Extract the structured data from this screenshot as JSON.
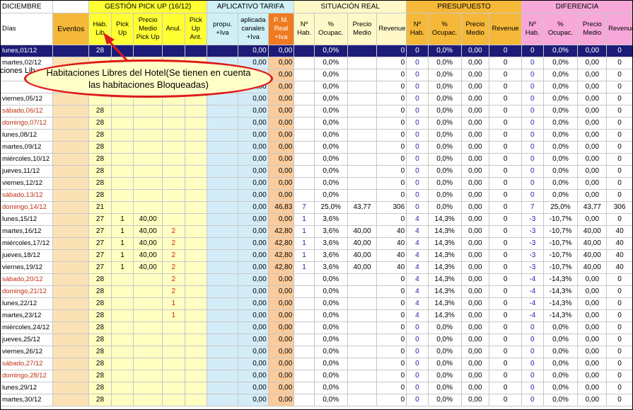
{
  "month_label": "DICIEMBRE",
  "days_label": "Días",
  "group_headers": {
    "pickup": "GESTIÓN PICK UP (16/12)",
    "tarifa": "APLICATIVO TARIFA",
    "situacion": "SITUACIÓN REAL",
    "presupuesto": "PRESUPUESTO",
    "diferencia": "DIFERENCIA"
  },
  "column_headers": {
    "eventos": "Eventos",
    "hab_lib": "Hab. Lib",
    "pick_up": "Pick Up",
    "precio_pickup": "Precio Medio Pick Up",
    "anul": "Anul.",
    "pickup_ant": "Pick Up Ant.",
    "propu": "propu. +Iva",
    "aplicada": "aplicada canales +Iva",
    "pm_real": "P. M. Real +Iva",
    "n_hab": "Nº Hab.",
    "ocupac": "% Ocupac.",
    "precio_medio": "Precio Medio",
    "revenue": "Revenue"
  },
  "overflow_text": "ciones Lib",
  "annotation": "Habitaciones Libres del Hotel(Se tienen en cuenta las habitaciones Bloqueadas)",
  "rows": [
    {
      "day": "lunes,01/12",
      "we": false,
      "sel": true,
      "hab": "28",
      "pick": "",
      "pmp": "",
      "anul": "",
      "pua": "",
      "propu": "0,00",
      "aplic": "0,00",
      "pmr": "",
      "s_n": "",
      "s_oc": "0,0%",
      "s_pm": "",
      "s_rev": "0",
      "p_n": "0",
      "p_oc": "0,0%",
      "p_pm": "0,00",
      "p_rev": "0",
      "d_n": "0",
      "d_oc": "0,0%",
      "d_pm": "0,00",
      "d_rev": "0"
    },
    {
      "day": "martes,02/12",
      "we": false,
      "hab": "",
      "pick": "",
      "pmp": "",
      "anul": "",
      "pua": "",
      "propu": "0,00",
      "aplic": "0,00",
      "pmr": "",
      "s_n": "",
      "s_oc": "0,0%",
      "s_pm": "",
      "s_rev": "0",
      "p_n": "0",
      "p_oc": "0,0%",
      "p_pm": "0,00",
      "p_rev": "0",
      "d_n": "0",
      "d_oc": "0,0%",
      "d_pm": "0,00",
      "d_rev": "0"
    },
    {
      "day": "",
      "we": false,
      "hab": "",
      "pick": "",
      "pmp": "",
      "anul": "",
      "pua": "",
      "propu": "0,00",
      "aplic": "0,00",
      "pmr": "",
      "s_n": "",
      "s_oc": "0,0%",
      "s_pm": "",
      "s_rev": "0",
      "p_n": "0",
      "p_oc": "0,0%",
      "p_pm": "0,00",
      "p_rev": "0",
      "d_n": "0",
      "d_oc": "0,0%",
      "d_pm": "0,00",
      "d_rev": "0"
    },
    {
      "day": "",
      "we": false,
      "hab": "",
      "pick": "",
      "pmp": "",
      "anul": "",
      "pua": "",
      "propu": "0,00",
      "aplic": "0,00",
      "pmr": "",
      "s_n": "",
      "s_oc": "0,0%",
      "s_pm": "",
      "s_rev": "0",
      "p_n": "0",
      "p_oc": "0,0%",
      "p_pm": "0,00",
      "p_rev": "0",
      "d_n": "0",
      "d_oc": "0,0%",
      "d_pm": "0,00",
      "d_rev": "0"
    },
    {
      "day": "viernes,05/12",
      "we": false,
      "hab": "",
      "pick": "",
      "pmp": "",
      "anul": "",
      "pua": "",
      "propu": "0,00",
      "aplic": "0,00",
      "pmr": "",
      "s_n": "",
      "s_oc": "0,0%",
      "s_pm": "",
      "s_rev": "0",
      "p_n": "0",
      "p_oc": "0,0%",
      "p_pm": "0,00",
      "p_rev": "0",
      "d_n": "0",
      "d_oc": "0,0%",
      "d_pm": "0,00",
      "d_rev": "0"
    },
    {
      "day": "sábado,06/12",
      "we": true,
      "hab": "28",
      "pick": "",
      "pmp": "",
      "anul": "",
      "pua": "",
      "propu": "0,00",
      "aplic": "0,00",
      "pmr": "",
      "s_n": "",
      "s_oc": "0,0%",
      "s_pm": "",
      "s_rev": "0",
      "p_n": "0",
      "p_oc": "0,0%",
      "p_pm": "0,00",
      "p_rev": "0",
      "d_n": "0",
      "d_oc": "0,0%",
      "d_pm": "0,00",
      "d_rev": "0"
    },
    {
      "day": "domingo,07/12",
      "we": true,
      "hab": "28",
      "pick": "",
      "pmp": "",
      "anul": "",
      "pua": "",
      "propu": "0,00",
      "aplic": "0,00",
      "pmr": "",
      "s_n": "",
      "s_oc": "0,0%",
      "s_pm": "",
      "s_rev": "0",
      "p_n": "0",
      "p_oc": "0,0%",
      "p_pm": "0,00",
      "p_rev": "0",
      "d_n": "0",
      "d_oc": "0,0%",
      "d_pm": "0,00",
      "d_rev": "0"
    },
    {
      "day": "lunes,08/12",
      "we": false,
      "hab": "28",
      "pick": "",
      "pmp": "",
      "anul": "",
      "pua": "",
      "propu": "0,00",
      "aplic": "0,00",
      "pmr": "",
      "s_n": "",
      "s_oc": "0,0%",
      "s_pm": "",
      "s_rev": "0",
      "p_n": "0",
      "p_oc": "0,0%",
      "p_pm": "0,00",
      "p_rev": "0",
      "d_n": "0",
      "d_oc": "0,0%",
      "d_pm": "0,00",
      "d_rev": "0"
    },
    {
      "day": "martes,09/12",
      "we": false,
      "hab": "28",
      "pick": "",
      "pmp": "",
      "anul": "",
      "pua": "",
      "propu": "0,00",
      "aplic": "0,00",
      "pmr": "",
      "s_n": "",
      "s_oc": "0,0%",
      "s_pm": "",
      "s_rev": "0",
      "p_n": "0",
      "p_oc": "0,0%",
      "p_pm": "0,00",
      "p_rev": "0",
      "d_n": "0",
      "d_oc": "0,0%",
      "d_pm": "0,00",
      "d_rev": "0"
    },
    {
      "day": "miércoles,10/12",
      "we": false,
      "hab": "28",
      "pick": "",
      "pmp": "",
      "anul": "",
      "pua": "",
      "propu": "0,00",
      "aplic": "0,00",
      "pmr": "",
      "s_n": "",
      "s_oc": "0,0%",
      "s_pm": "",
      "s_rev": "0",
      "p_n": "0",
      "p_oc": "0,0%",
      "p_pm": "0,00",
      "p_rev": "0",
      "d_n": "0",
      "d_oc": "0,0%",
      "d_pm": "0,00",
      "d_rev": "0"
    },
    {
      "day": "jueves,11/12",
      "we": false,
      "hab": "28",
      "pick": "",
      "pmp": "",
      "anul": "",
      "pua": "",
      "propu": "0,00",
      "aplic": "0,00",
      "pmr": "",
      "s_n": "",
      "s_oc": "0,0%",
      "s_pm": "",
      "s_rev": "0",
      "p_n": "0",
      "p_oc": "0,0%",
      "p_pm": "0,00",
      "p_rev": "0",
      "d_n": "0",
      "d_oc": "0,0%",
      "d_pm": "0,00",
      "d_rev": "0"
    },
    {
      "day": "viernes,12/12",
      "we": false,
      "hab": "28",
      "pick": "",
      "pmp": "",
      "anul": "",
      "pua": "",
      "propu": "0,00",
      "aplic": "0,00",
      "pmr": "",
      "s_n": "",
      "s_oc": "0,0%",
      "s_pm": "",
      "s_rev": "0",
      "p_n": "0",
      "p_oc": "0,0%",
      "p_pm": "0,00",
      "p_rev": "0",
      "d_n": "0",
      "d_oc": "0,0%",
      "d_pm": "0,00",
      "d_rev": "0"
    },
    {
      "day": "sábado,13/12",
      "we": true,
      "hab": "28",
      "pick": "",
      "pmp": "",
      "anul": "",
      "pua": "",
      "propu": "0,00",
      "aplic": "0,00",
      "pmr": "",
      "s_n": "",
      "s_oc": "0,0%",
      "s_pm": "",
      "s_rev": "0",
      "p_n": "0",
      "p_oc": "0,0%",
      "p_pm": "0,00",
      "p_rev": "0",
      "d_n": "0",
      "d_oc": "0,0%",
      "d_pm": "0,00",
      "d_rev": "0"
    },
    {
      "day": "domingo,14/12",
      "we": true,
      "hab": "21",
      "pick": "",
      "pmp": "",
      "anul": "",
      "pua": "",
      "propu": "0,00",
      "aplic": "46,83",
      "pmr": "",
      "s_n": "7",
      "s_oc": "25,0%",
      "s_pm": "43,77",
      "s_rev": "306",
      "p_n": "0",
      "p_oc": "0,0%",
      "p_pm": "0,00",
      "p_rev": "0",
      "d_n": "7",
      "d_oc": "25,0%",
      "d_pm": "43,77",
      "d_rev": "306"
    },
    {
      "day": "lunes,15/12",
      "we": false,
      "hab": "27",
      "pick": "1",
      "pmp": "40,00",
      "anul": "",
      "pua": "",
      "propu": "0,00",
      "aplic": "0,00",
      "pmr": "",
      "s_n": "1",
      "s_oc": "3,6%",
      "s_pm": "",
      "s_rev": "0",
      "p_n": "4",
      "p_oc": "14,3%",
      "p_pm": "0,00",
      "p_rev": "0",
      "d_n": "-3",
      "d_oc": "-10,7%",
      "d_pm": "0,00",
      "d_rev": "0"
    },
    {
      "day": "martes,16/12",
      "we": false,
      "hab": "27",
      "pick": "1",
      "pmp": "40,00",
      "anul": "2",
      "pua": "",
      "propu": "0,00",
      "aplic": "42,80",
      "pmr": "",
      "s_n": "1",
      "s_oc": "3,6%",
      "s_pm": "40,00",
      "s_rev": "40",
      "p_n": "4",
      "p_oc": "14,3%",
      "p_pm": "0,00",
      "p_rev": "0",
      "d_n": "-3",
      "d_oc": "-10,7%",
      "d_pm": "40,00",
      "d_rev": "40"
    },
    {
      "day": "miércoles,17/12",
      "we": false,
      "hab": "27",
      "pick": "1",
      "pmp": "40,00",
      "anul": "2",
      "pua": "",
      "propu": "0,00",
      "aplic": "42,80",
      "pmr": "",
      "s_n": "1",
      "s_oc": "3,6%",
      "s_pm": "40,00",
      "s_rev": "40",
      "p_n": "4",
      "p_oc": "14,3%",
      "p_pm": "0,00",
      "p_rev": "0",
      "d_n": "-3",
      "d_oc": "-10,7%",
      "d_pm": "40,00",
      "d_rev": "40"
    },
    {
      "day": "jueves,18/12",
      "we": false,
      "hab": "27",
      "pick": "1",
      "pmp": "40,00",
      "anul": "2",
      "pua": "",
      "propu": "0,00",
      "aplic": "42,80",
      "pmr": "",
      "s_n": "1",
      "s_oc": "3,6%",
      "s_pm": "40,00",
      "s_rev": "40",
      "p_n": "4",
      "p_oc": "14,3%",
      "p_pm": "0,00",
      "p_rev": "0",
      "d_n": "-3",
      "d_oc": "-10,7%",
      "d_pm": "40,00",
      "d_rev": "40"
    },
    {
      "day": "viernes,19/12",
      "we": false,
      "hab": "27",
      "pick": "1",
      "pmp": "40,00",
      "anul": "2",
      "pua": "",
      "propu": "0,00",
      "aplic": "42,80",
      "pmr": "",
      "s_n": "1",
      "s_oc": "3,6%",
      "s_pm": "40,00",
      "s_rev": "40",
      "p_n": "4",
      "p_oc": "14,3%",
      "p_pm": "0,00",
      "p_rev": "0",
      "d_n": "-3",
      "d_oc": "-10,7%",
      "d_pm": "40,00",
      "d_rev": "40"
    },
    {
      "day": "sábado,20/12",
      "we": true,
      "hab": "28",
      "pick": "",
      "pmp": "",
      "anul": "2",
      "pua": "",
      "propu": "0,00",
      "aplic": "0,00",
      "pmr": "",
      "s_n": "",
      "s_oc": "0,0%",
      "s_pm": "",
      "s_rev": "0",
      "p_n": "4",
      "p_oc": "14,3%",
      "p_pm": "0,00",
      "p_rev": "0",
      "d_n": "-4",
      "d_oc": "-14,3%",
      "d_pm": "0,00",
      "d_rev": "0"
    },
    {
      "day": "domingo,21/12",
      "we": true,
      "hab": "28",
      "pick": "",
      "pmp": "",
      "anul": "2",
      "pua": "",
      "propu": "0,00",
      "aplic": "0,00",
      "pmr": "",
      "s_n": "",
      "s_oc": "0,0%",
      "s_pm": "",
      "s_rev": "0",
      "p_n": "4",
      "p_oc": "14,3%",
      "p_pm": "0,00",
      "p_rev": "0",
      "d_n": "-4",
      "d_oc": "-14,3%",
      "d_pm": "0,00",
      "d_rev": "0"
    },
    {
      "day": "lunes,22/12",
      "we": false,
      "hab": "28",
      "pick": "",
      "pmp": "",
      "anul": "1",
      "pua": "",
      "propu": "0,00",
      "aplic": "0,00",
      "pmr": "",
      "s_n": "",
      "s_oc": "0,0%",
      "s_pm": "",
      "s_rev": "0",
      "p_n": "4",
      "p_oc": "14,3%",
      "p_pm": "0,00",
      "p_rev": "0",
      "d_n": "-4",
      "d_oc": "-14,3%",
      "d_pm": "0,00",
      "d_rev": "0"
    },
    {
      "day": "martes,23/12",
      "we": false,
      "hab": "28",
      "pick": "",
      "pmp": "",
      "anul": "1",
      "pua": "",
      "propu": "0,00",
      "aplic": "0,00",
      "pmr": "",
      "s_n": "",
      "s_oc": "0,0%",
      "s_pm": "",
      "s_rev": "0",
      "p_n": "4",
      "p_oc": "14,3%",
      "p_pm": "0,00",
      "p_rev": "0",
      "d_n": "-4",
      "d_oc": "-14,3%",
      "d_pm": "0,00",
      "d_rev": "0"
    },
    {
      "day": "miércoles,24/12",
      "we": false,
      "hab": "28",
      "pick": "",
      "pmp": "",
      "anul": "",
      "pua": "",
      "propu": "0,00",
      "aplic": "0,00",
      "pmr": "",
      "s_n": "",
      "s_oc": "0,0%",
      "s_pm": "",
      "s_rev": "0",
      "p_n": "0",
      "p_oc": "0,0%",
      "p_pm": "0,00",
      "p_rev": "0",
      "d_n": "0",
      "d_oc": "0,0%",
      "d_pm": "0,00",
      "d_rev": "0"
    },
    {
      "day": "jueves,25/12",
      "we": false,
      "hab": "28",
      "pick": "",
      "pmp": "",
      "anul": "",
      "pua": "",
      "propu": "0,00",
      "aplic": "0,00",
      "pmr": "",
      "s_n": "",
      "s_oc": "0,0%",
      "s_pm": "",
      "s_rev": "0",
      "p_n": "0",
      "p_oc": "0,0%",
      "p_pm": "0,00",
      "p_rev": "0",
      "d_n": "0",
      "d_oc": "0,0%",
      "d_pm": "0,00",
      "d_rev": "0"
    },
    {
      "day": "viernes,26/12",
      "we": false,
      "hab": "28",
      "pick": "",
      "pmp": "",
      "anul": "",
      "pua": "",
      "propu": "0,00",
      "aplic": "0,00",
      "pmr": "",
      "s_n": "",
      "s_oc": "0,0%",
      "s_pm": "",
      "s_rev": "0",
      "p_n": "0",
      "p_oc": "0,0%",
      "p_pm": "0,00",
      "p_rev": "0",
      "d_n": "0",
      "d_oc": "0,0%",
      "d_pm": "0,00",
      "d_rev": "0"
    },
    {
      "day": "sábado,27/12",
      "we": true,
      "hab": "28",
      "pick": "",
      "pmp": "",
      "anul": "",
      "pua": "",
      "propu": "0,00",
      "aplic": "0,00",
      "pmr": "",
      "s_n": "",
      "s_oc": "0,0%",
      "s_pm": "",
      "s_rev": "0",
      "p_n": "0",
      "p_oc": "0,0%",
      "p_pm": "0,00",
      "p_rev": "0",
      "d_n": "0",
      "d_oc": "0,0%",
      "d_pm": "0,00",
      "d_rev": "0"
    },
    {
      "day": "domingo,28/12",
      "we": true,
      "hab": "28",
      "pick": "",
      "pmp": "",
      "anul": "",
      "pua": "",
      "propu": "0,00",
      "aplic": "0,00",
      "pmr": "",
      "s_n": "",
      "s_oc": "0,0%",
      "s_pm": "",
      "s_rev": "0",
      "p_n": "0",
      "p_oc": "0,0%",
      "p_pm": "0,00",
      "p_rev": "0",
      "d_n": "0",
      "d_oc": "0,0%",
      "d_pm": "0,00",
      "d_rev": "0"
    },
    {
      "day": "lunes,29/12",
      "we": false,
      "hab": "28",
      "pick": "",
      "pmp": "",
      "anul": "",
      "pua": "",
      "propu": "0,00",
      "aplic": "0,00",
      "pmr": "",
      "s_n": "",
      "s_oc": "0,0%",
      "s_pm": "",
      "s_rev": "0",
      "p_n": "0",
      "p_oc": "0,0%",
      "p_pm": "0,00",
      "p_rev": "0",
      "d_n": "0",
      "d_oc": "0,0%",
      "d_pm": "0,00",
      "d_rev": "0"
    },
    {
      "day": "martes,30/12",
      "we": false,
      "hab": "28",
      "pick": "",
      "pmp": "",
      "anul": "",
      "pua": "",
      "propu": "0,00",
      "aplic": "0,00",
      "pmr": "",
      "s_n": "",
      "s_oc": "0,0%",
      "s_pm": "",
      "s_rev": "0",
      "p_n": "0",
      "p_oc": "0,0%",
      "p_pm": "0,00",
      "p_rev": "0",
      "d_n": "0",
      "d_oc": "0,0%",
      "d_pm": "0,00",
      "d_rev": "0"
    }
  ]
}
